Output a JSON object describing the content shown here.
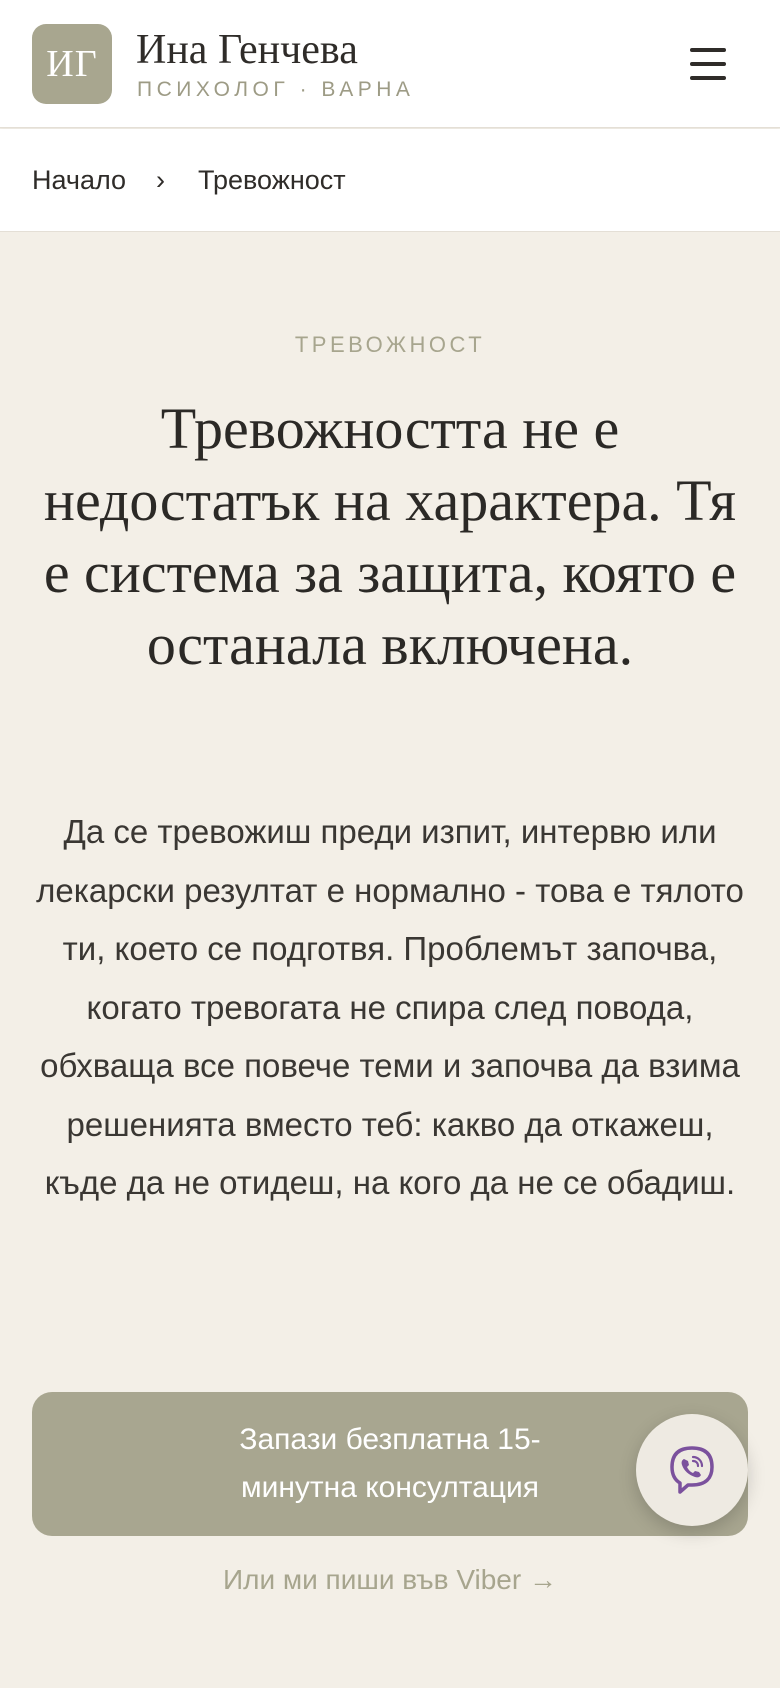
{
  "header": {
    "logo_initials": "ИГ",
    "name": "Ина Генчева",
    "subtitle": "ПСИХОЛОГ · ВАРНА",
    "menu_icon": "hamburger-menu-icon"
  },
  "breadcrumb": {
    "home": "Начало",
    "separator": "›",
    "current": "Тревожност"
  },
  "hero": {
    "eyebrow": "ТРЕВОЖНОСТ",
    "headline": "Тревожността не е недостатък на характера. Тя е система за защита, която е останала включена.",
    "intro": "Да се тревожиш преди изпит, интервю или лекарски резултат е нормално - това е тялото ти, което се подготвя. Проблемът започва, когато тревогата не спира след повода, обхваща все повече теми и започва да взима решенията вместо теб: какво да откажеш, къде да не отидеш, на кого да не се обадиш.",
    "cta_label": "Запази безплатна 15-минутна консултация",
    "viber_link": "Или ми пиши във Viber →"
  },
  "fab": {
    "icon": "viber-icon"
  },
  "colors": {
    "background": "#f3efe7",
    "accent": "#a8a690",
    "text": "#2f2c29",
    "muted": "#a7a58e",
    "viber": "#7b519d"
  }
}
